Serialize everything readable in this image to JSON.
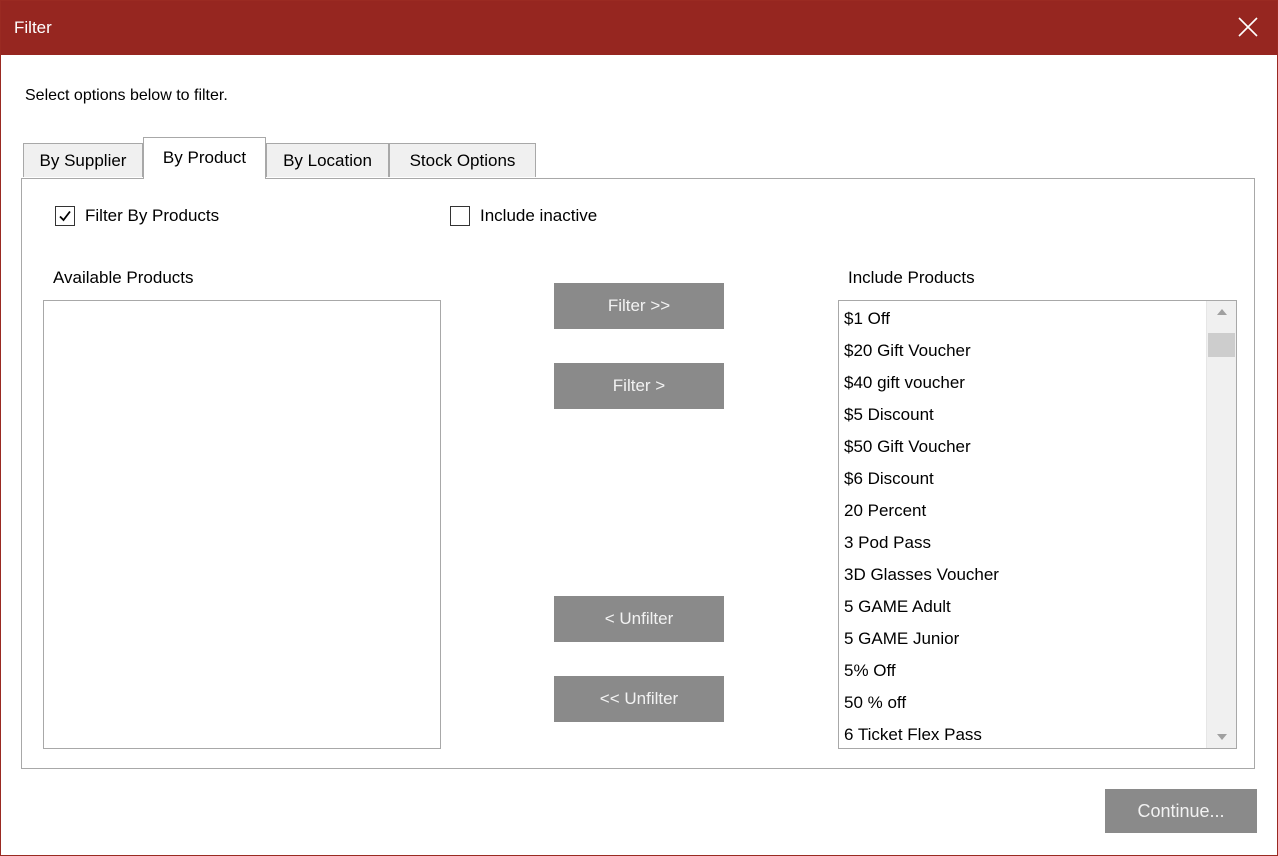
{
  "window": {
    "title": "Filter"
  },
  "instruction": "Select options below to filter.",
  "tabs": [
    {
      "label": "By Supplier",
      "active": false
    },
    {
      "label": "By Product",
      "active": true
    },
    {
      "label": "By Location",
      "active": false
    },
    {
      "label": "Stock Options",
      "active": false
    }
  ],
  "filter_by_products": {
    "label": "Filter By Products",
    "checked": true
  },
  "include_inactive": {
    "label": "Include inactive",
    "checked": false
  },
  "available": {
    "label": "Available Products",
    "items": []
  },
  "include": {
    "label": "Include Products",
    "items": [
      "$1 Off",
      "$20 Gift Voucher",
      "$40 gift voucher",
      "$5 Discount",
      "$50 Gift Voucher",
      "$6 Discount",
      "20 Percent",
      "3 Pod Pass",
      "3D Glasses Voucher",
      "5 GAME Adult",
      "5 GAME Junior",
      "5% Off",
      "50 % off",
      "6 Ticket Flex Pass"
    ]
  },
  "buttons": {
    "filter_all": "Filter >>",
    "filter": "Filter >",
    "unfilter": "< Unfilter",
    "unfilter_all": "<< Unfilter",
    "continue": "Continue..."
  },
  "colors": {
    "titlebar": "#962620",
    "button": "#8a8a8a",
    "button_text": "#f2f2f2"
  },
  "icons": {
    "close": "close-icon",
    "check": "checkmark-icon",
    "scroll_up": "scroll-up-arrow-icon",
    "scroll_down": "scroll-down-arrow-icon"
  }
}
